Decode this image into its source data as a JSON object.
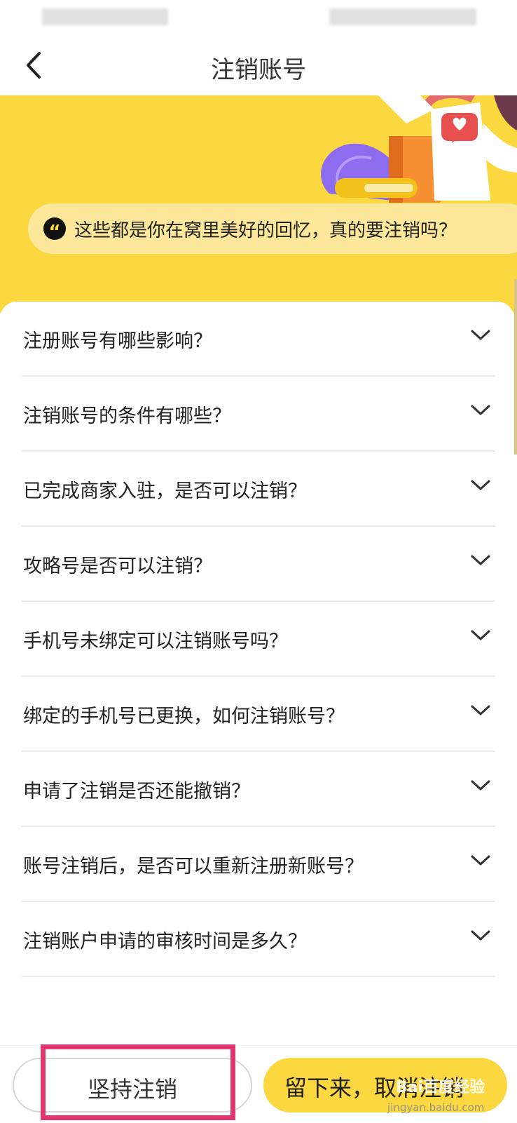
{
  "header": {
    "title": "注销账号"
  },
  "hero": {
    "quote": "这些都是你在窝里美好的回忆，真的要注销吗？"
  },
  "faq": [
    {
      "q": "注册账号有哪些影响？"
    },
    {
      "q": "注销账号的条件有哪些？"
    },
    {
      "q": "已完成商家入驻，是否可以注销？"
    },
    {
      "q": "攻略号是否可以注销？"
    },
    {
      "q": "手机号未绑定可以注销账号吗？"
    },
    {
      "q": "绑定的手机号已更换，如何注销账号？"
    },
    {
      "q": "申请了注销是否还能撤销？"
    },
    {
      "q": "账号注销后，是否可以重新注册新账号？"
    },
    {
      "q": "注销账户申请的审核时间是多久？"
    }
  ],
  "actions": {
    "insist": "坚持注销",
    "stay": "留下来，取消注销"
  },
  "watermark": {
    "main": "Bai百度经验",
    "sub": "jingyan.baidu.com"
  },
  "colors": {
    "accent": "#fbd840",
    "highlight": "#e0356f"
  },
  "icons": {
    "back": "chevron-left-icon",
    "quote": "quote-icon",
    "expand": "chevron-down-icon"
  }
}
